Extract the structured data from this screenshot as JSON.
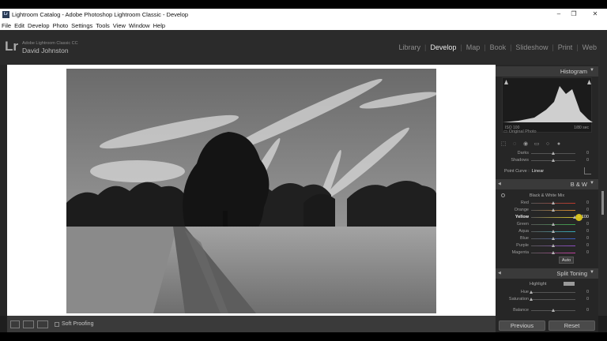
{
  "window": {
    "title": "Lightroom Catalog - Adobe Photoshop Lightroom Classic - Develop",
    "icon": "Lr",
    "minimize": "–",
    "restore": "❐",
    "close": "✕"
  },
  "menu": [
    "File",
    "Edit",
    "Develop",
    "Photo",
    "Settings",
    "Tools",
    "View",
    "Window",
    "Help"
  ],
  "identity": {
    "logo": "Lr",
    "product": "Adobe Lightroom Classic CC",
    "user": "David Johnston"
  },
  "modules": [
    {
      "label": "Library",
      "active": false
    },
    {
      "label": "Develop",
      "active": true
    },
    {
      "label": "Map",
      "active": false
    },
    {
      "label": "Book",
      "active": false
    },
    {
      "label": "Slideshow",
      "active": false
    },
    {
      "label": "Print",
      "active": false
    },
    {
      "label": "Web",
      "active": false
    }
  ],
  "toolbar": {
    "soft_proofing": "Soft Proofing"
  },
  "histogram": {
    "header": "Histogram",
    "iso": "ISO 100",
    "shutter": "1/80 sec",
    "original_photo": "Original Photo"
  },
  "tone": {
    "rows": [
      {
        "label": "Darks",
        "value": "0"
      },
      {
        "label": "Shadows",
        "value": "0"
      }
    ],
    "point_curve_label": "Point Curve :",
    "point_curve_value": "Linear"
  },
  "bw": {
    "header": "B & W",
    "mix_title": "Black & White Mix",
    "channels": [
      {
        "label": "Red",
        "value": "0",
        "level": 0.5,
        "color": "#c0392b",
        "active": false
      },
      {
        "label": "Orange",
        "value": "0",
        "level": 0.5,
        "color": "#d98b2b",
        "active": false
      },
      {
        "label": "Yellow",
        "value": "+ 100",
        "level": 0.98,
        "color": "#d8c52a",
        "active": true
      },
      {
        "label": "Green",
        "value": "0",
        "level": 0.5,
        "color": "#3fa34d",
        "active": false
      },
      {
        "label": "Aqua",
        "value": "0",
        "level": 0.5,
        "color": "#36a9b5",
        "active": false
      },
      {
        "label": "Blue",
        "value": "0",
        "level": 0.5,
        "color": "#3a5fc6",
        "active": false
      },
      {
        "label": "Purple",
        "value": "0",
        "level": 0.5,
        "color": "#8e4dc4",
        "active": false
      },
      {
        "label": "Magenta",
        "value": "0",
        "level": 0.5,
        "color": "#c23fa0",
        "active": false
      }
    ],
    "auto_label": "Auto"
  },
  "split_toning": {
    "header": "Split Toning",
    "highlight_label": "Highlight",
    "rows": [
      {
        "label": "Hue",
        "value": "0",
        "level": 0.0
      },
      {
        "label": "Saturation",
        "value": "0",
        "level": 0.0
      },
      {
        "label": "Balance",
        "value": "0",
        "level": 0.5
      }
    ]
  },
  "buttons": {
    "previous": "Previous",
    "reset": "Reset"
  }
}
